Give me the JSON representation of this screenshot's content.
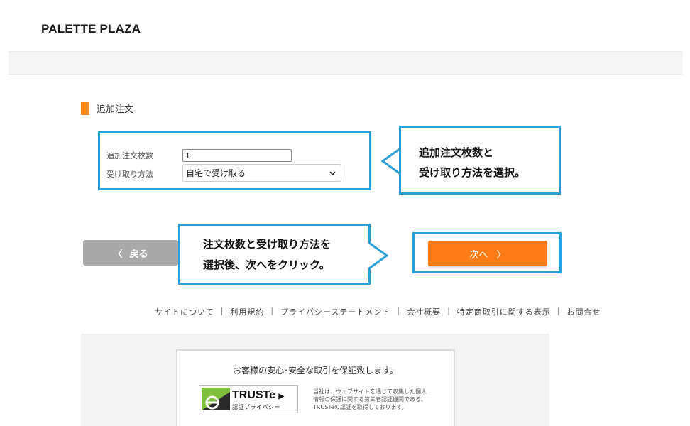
{
  "header": {
    "logo": "PALETTE PLAZA"
  },
  "section": {
    "title": "追加注文"
  },
  "form": {
    "qty_label": "追加注文枚数",
    "qty_value": "1",
    "method_label": "受け取り方法",
    "method_selected": "自宅で受け取る"
  },
  "callouts": {
    "select": {
      "line1": "追加注文枚数と",
      "line2": "受け取り方法を選択。"
    },
    "click": {
      "line1": "注文枚数と受け取り方法を",
      "line2": "選択後、次へをクリック。"
    }
  },
  "buttons": {
    "back_label": "戻る",
    "back_chevron": "〈",
    "next_label": "次へ",
    "next_chevron": "〉"
  },
  "footer": {
    "links": [
      "サイトについて",
      "利用規約",
      "プライバシーステートメント",
      "会社概要",
      "特定商取引に関する表示",
      "お問合せ"
    ],
    "separator": "|"
  },
  "trust": {
    "title": "お客様の安心･安全な取引を保証致します。",
    "logo_word": "TRUSTe",
    "logo_arrow": "▶",
    "logo_sub": "認証プライバシー",
    "desc_line1": "当社は、ウェブサイトを通じて収集した個人",
    "desc_line2": "情報の保護に関する第三者認証機関である、",
    "desc_line3": "TRUSTeの認証を取得しております。"
  },
  "colors": {
    "accent": "#ff7b17",
    "callout_border": "#2c9fd8",
    "back_button": "#aaaaaa",
    "truste_green": "#7fbf3a"
  }
}
